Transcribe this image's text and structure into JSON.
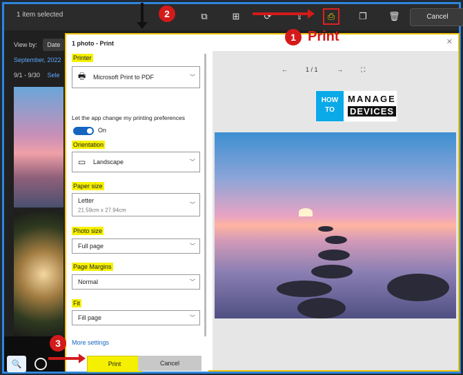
{
  "app": {
    "selection_status": "1 item selected",
    "cancel_label": "Cancel",
    "view_by_label": "View by:",
    "view_by_value": "Date",
    "month_label": "September, 2022",
    "date_range": "9/1 - 9/30",
    "select_label": "Sele"
  },
  "dialog": {
    "title": "1 photo - Print",
    "close_glyph": "✕",
    "printer": {
      "label": "Printer",
      "value": "Microsoft Print to PDF"
    },
    "preferences_text": "Let the app change my printing preferences",
    "preferences_toggle_label": "On",
    "orientation": {
      "label": "Orientation",
      "value": "Landscape"
    },
    "paper_size": {
      "label": "Paper size",
      "value": "Letter",
      "detail": "21.59cm x 27.94cm"
    },
    "photo_size": {
      "label": "Photo size",
      "value": "Full page"
    },
    "page_margins": {
      "label": "Page Margins",
      "value": "Normal"
    },
    "fit": {
      "label": "Fit",
      "value": "Fill page"
    },
    "more_settings": "More settings",
    "print_button": "Print",
    "cancel_button": "Cancel",
    "pager": {
      "prev": "←",
      "current": "1 / 1",
      "next": "→"
    }
  },
  "logo": {
    "how": "HOW TO",
    "manage": "MANAGE",
    "devices": "DEVICES"
  },
  "annotations": {
    "step1": "1",
    "step1_text": "Print",
    "step2": "2",
    "step3": "3"
  },
  "colors": {
    "highlight": "#f5f000",
    "annotation": "#d41a1a",
    "accent": "#1565c0"
  }
}
